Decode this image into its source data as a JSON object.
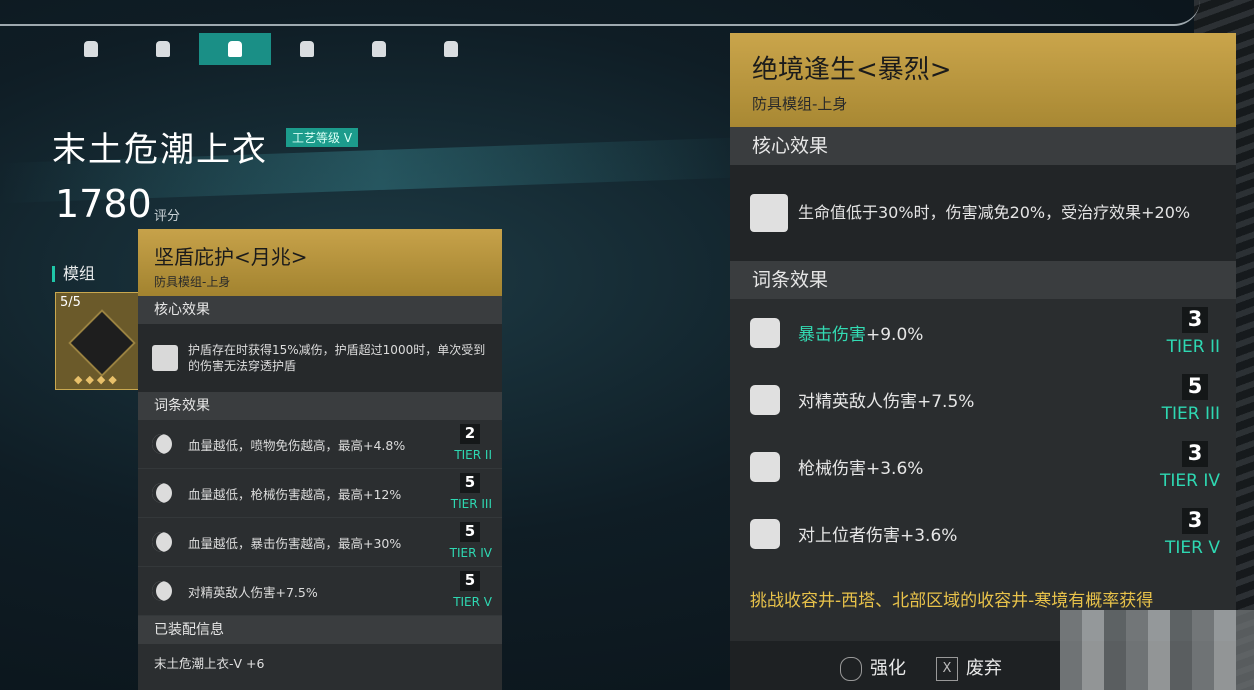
{
  "slot_tabs": [
    {
      "icon": "helmet-icon"
    },
    {
      "icon": "mask-icon"
    },
    {
      "icon": "chest-armor-icon",
      "active": true
    },
    {
      "icon": "legs-armor-icon"
    },
    {
      "icon": "gloves-icon"
    },
    {
      "icon": "boots-icon"
    }
  ],
  "item": {
    "name": "末土危潮上衣",
    "craft_badge": "工艺等级 V",
    "score": "1780",
    "score_label": "评分"
  },
  "mods": {
    "header": "模组",
    "count": "5/5"
  },
  "tooltip": {
    "title": "坚盾庇护<月兆>",
    "subtitle": "防具模组-上身",
    "core_header": "核心效果",
    "core_text": "护盾存在时获得15%减伤，护盾超过1000时，单次受到的伤害无法穿透护盾",
    "affix_header": "词条效果",
    "affixes": [
      {
        "text": "血量越低，喷物免伤越高，最高+4.8%",
        "level": "2",
        "tier": "TIER II"
      },
      {
        "text": "血量越低，枪械伤害越高，最高+12%",
        "level": "5",
        "tier": "TIER III"
      },
      {
        "text": "血量越低，暴击伤害越高，最高+30%",
        "level": "5",
        "tier": "TIER IV"
      },
      {
        "text": "对精英敌人伤害+7.5%",
        "level": "5",
        "tier": "TIER V"
      }
    ],
    "equip_header": "已装配信息",
    "equip_text": "末土危潮上衣-V +6"
  },
  "detail": {
    "title": "绝境逢生<暴烈>",
    "subtitle": "防具模组-上身",
    "core_header": "核心效果",
    "core_text": "生命值低于30%时，伤害减免20%，受治疗效果+20%",
    "affix_header": "词条效果",
    "affixes": [
      {
        "highlight": "暴击伤害",
        "text": "+9.0%",
        "level": "3",
        "tier": "TIER II"
      },
      {
        "highlight": "",
        "text": "对精英敌人伤害+7.5%",
        "level": "5",
        "tier": "TIER III"
      },
      {
        "highlight": "",
        "text": "枪械伤害+3.6%",
        "level": "3",
        "tier": "TIER IV"
      },
      {
        "highlight": "",
        "text": "对上位者伤害+3.6%",
        "level": "3",
        "tier": "TIER V"
      }
    ],
    "source": "挑战收容井-西塔、北部区域的收容井-寒境有概率获得"
  },
  "actions": {
    "enhance": "强化",
    "discard_key": "X",
    "discard": "废弃"
  },
  "colors": {
    "accent_teal": "#1a8f86",
    "tier_green": "#2ed8b2",
    "gold_header": "#c7a24a",
    "source_yellow": "#e8c24a"
  }
}
